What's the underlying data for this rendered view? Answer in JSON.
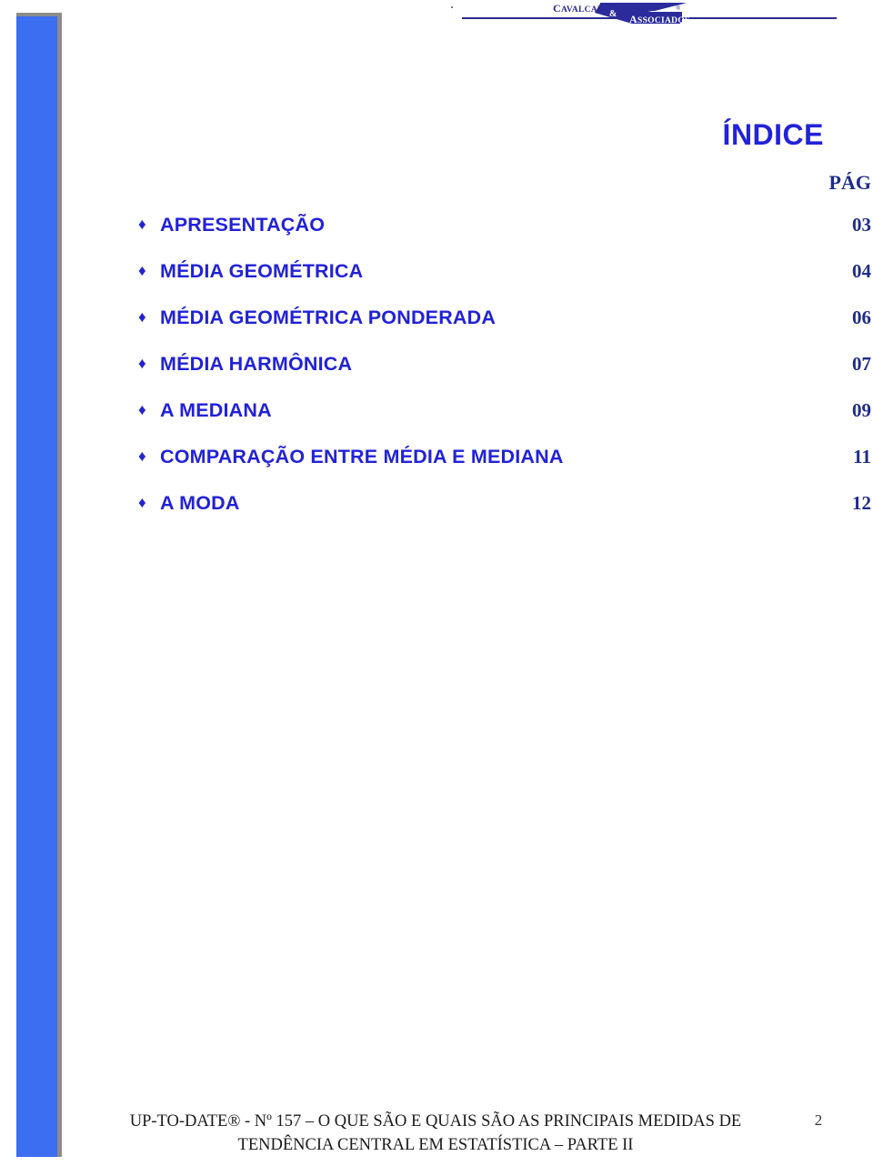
{
  "header": {
    "logo": {
      "name_top": "CAVALCANTE",
      "ampersand": "&",
      "name_bottom": "ASSOCIADOS",
      "registered_mark": "®",
      "brand_color": "#2b2b9c"
    }
  },
  "index": {
    "title": "ÍNDICE",
    "page_column_header": "PÁG",
    "bullet_glyph": "♦",
    "accent_color": "#2222d8",
    "page_number_color": "#1f2c8c",
    "entries": [
      {
        "label": "APRESENTAÇÃO",
        "page": "03"
      },
      {
        "label": "MÉDIA GEOMÉTRICA",
        "page": "04"
      },
      {
        "label": "MÉDIA GEOMÉTRICA PONDERADA",
        "page": "06"
      },
      {
        "label": "MÉDIA HARMÔNICA",
        "page": "07"
      },
      {
        "label": "A MEDIANA",
        "page": "09"
      },
      {
        "label": "COMPARAÇÃO ENTRE MÉDIA E MEDIANA",
        "page": "11"
      },
      {
        "label": "A MODA",
        "page": "12"
      }
    ]
  },
  "footer": {
    "line1": "UP-TO-DATE® - Nº 157 – O QUE SÃO E QUAIS SÃO AS PRINCIPAIS MEDIDAS DE",
    "line2": "TENDÊNCIA CENTRAL EM ESTATÍSTICA – PARTE II",
    "page_number": "2"
  }
}
